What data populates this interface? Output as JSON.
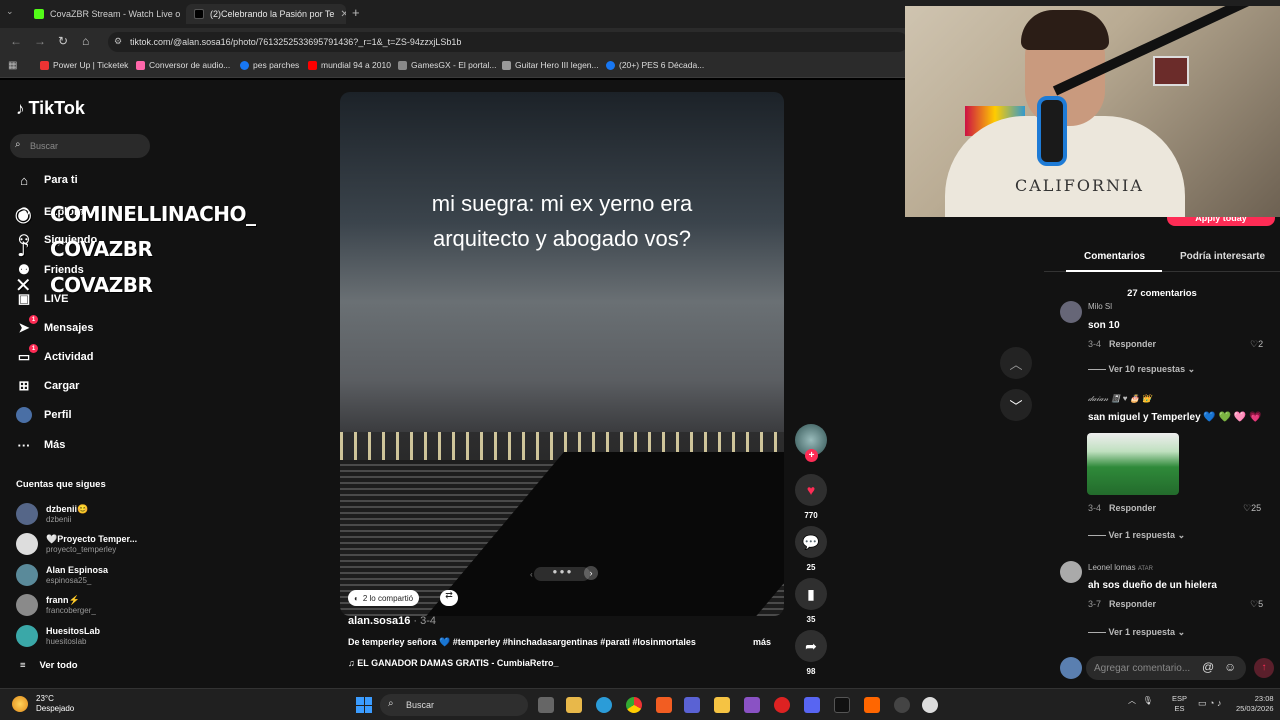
{
  "browser": {
    "tabs": [
      {
        "title": "CovaZBR Stream - Watch Live o",
        "active": false
      },
      {
        "title": "(2)Celebrando la Pasión por Te",
        "active": true
      }
    ],
    "url": "tiktok.com/@alan.sosa16/photo/7613252533695791436?_r=1&_t=ZS-94zzxjLSb1b",
    "bookmarks": [
      "Power Up | Ticketek",
      "Conversor de audio...",
      "pes parches",
      "mundial 94 a 2010",
      "GamesGX - El portal...",
      "Guitar Hero III legen...",
      "(20+) PES 6 Década..."
    ]
  },
  "sidebar": {
    "logo": "TikTok",
    "search_placeholder": "Buscar",
    "nav": [
      {
        "label": "Para ti",
        "icon": "home-icon"
      },
      {
        "label": "Explorar",
        "icon": "compass-icon"
      },
      {
        "label": "Siguiendo",
        "icon": "following-icon"
      },
      {
        "label": "Friends",
        "icon": "friends-icon"
      },
      {
        "label": "LIVE",
        "icon": "live-icon"
      },
      {
        "label": "Mensajes",
        "icon": "messages-icon",
        "badge": "1"
      },
      {
        "label": "Actividad",
        "icon": "activity-icon",
        "badge": "1"
      },
      {
        "label": "Cargar",
        "icon": "upload-icon"
      },
      {
        "label": "Perfil",
        "icon": "profile-icon"
      },
      {
        "label": "Más",
        "icon": "more-icon"
      }
    ],
    "following_header": "Cuentas que sigues",
    "following": [
      {
        "name": "dzbenii😊",
        "handle": "dzbenii",
        "color": "#556688"
      },
      {
        "name": "🤍Proyecto Temper...",
        "handle": "proyecto_temperley",
        "color": "#dddddd"
      },
      {
        "name": "Alan Espinosa",
        "handle": "espinosa25_",
        "color": "#5a8a9a"
      },
      {
        "name": "frann⚡",
        "handle": "francoberger_",
        "color": "#8a8a8a"
      },
      {
        "name": "HuesitosLab",
        "handle": "huesitoslab",
        "color": "#3aa8a8"
      }
    ],
    "see_all": "Ver todo"
  },
  "overlay": {
    "instagram": "COMINELLINACHO_",
    "tiktok": "COVAZBR",
    "x": "COVAZBR"
  },
  "post": {
    "caption_line1": "mi suegra: mi ex yerno era",
    "caption_line2": "arquitecto y abogado vos?",
    "shared_label": "2 lo compartió",
    "author": "alan.sosa16",
    "date": " · 3-4",
    "description": "De temperley señora 💙 #temperley #hinchadasargentinas #parati #losinmortales",
    "more": "más",
    "music": "EL GANADOR DAMAS GRATIS - CumbiaRetro_",
    "likes": "770",
    "comments": "25",
    "saves": "35",
    "shares": "98"
  },
  "comments_panel": {
    "apply_label": "Apply today",
    "tab_comments": "Comentarios",
    "tab_interest": "Podría interesarte",
    "count": "27 comentarios",
    "items": [
      {
        "user": "Milo Sl",
        "text": "son 10",
        "date": "3-4",
        "reply": "Responder",
        "likes": "2",
        "more": "Ver 10 respuestas"
      },
      {
        "user": "𝒹𝒶𝒾𝒶𝓃 📓 ♥ 🎂 👑",
        "text": "san miguel y Temperley 💙 💚 🩷 💗",
        "date": "3-4",
        "reply": "Responder",
        "likes": "25",
        "more": "Ver 1 respuesta"
      },
      {
        "user": "Leonel lomas",
        "user_tag": "ATAR",
        "text": "ah sos dueño de un hielera",
        "date": "3-7",
        "reply": "Responder",
        "likes": "5",
        "more": "Ver 1 respuesta"
      }
    ],
    "input_placeholder": "Agregar comentario..."
  },
  "taskbar": {
    "temp": "23°C",
    "weather": "Despejado",
    "search": "Buscar",
    "lang1": "ESP",
    "lang2": "ES",
    "time": "23:08",
    "date": "25/03/2026"
  }
}
